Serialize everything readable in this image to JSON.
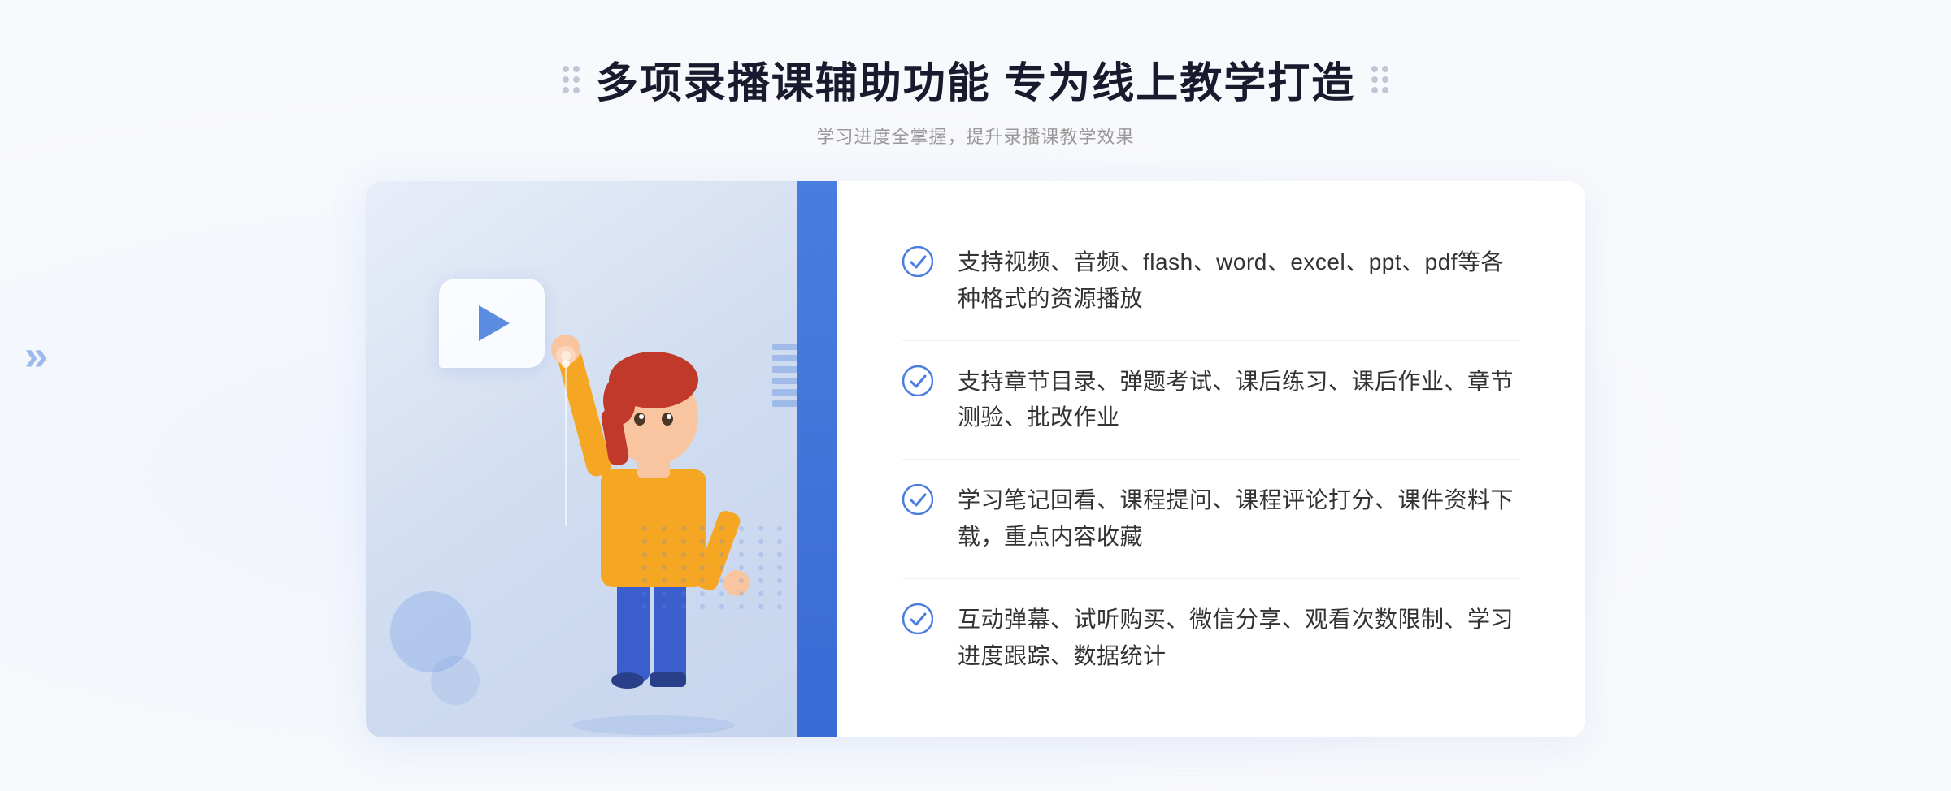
{
  "header": {
    "title": "多项录播课辅助功能 专为线上教学打造",
    "subtitle": "学习进度全掌握，提升录播课教学效果",
    "dots_left": true,
    "dots_right": true
  },
  "features": [
    {
      "id": 1,
      "text": "支持视频、音频、flash、word、excel、ppt、pdf等各种格式的资源播放"
    },
    {
      "id": 2,
      "text": "支持章节目录、弹题考试、课后练习、课后作业、章节测验、批改作业"
    },
    {
      "id": 3,
      "text": "学习笔记回看、课程提问、课程评论打分、课件资料下载，重点内容收藏"
    },
    {
      "id": 4,
      "text": "互动弹幕、试听购买、微信分享、观看次数限制、学习进度跟踪、数据统计"
    }
  ],
  "left_arrow": "»",
  "accent_color": "#4a7de0",
  "check_color": "#4a7de0"
}
